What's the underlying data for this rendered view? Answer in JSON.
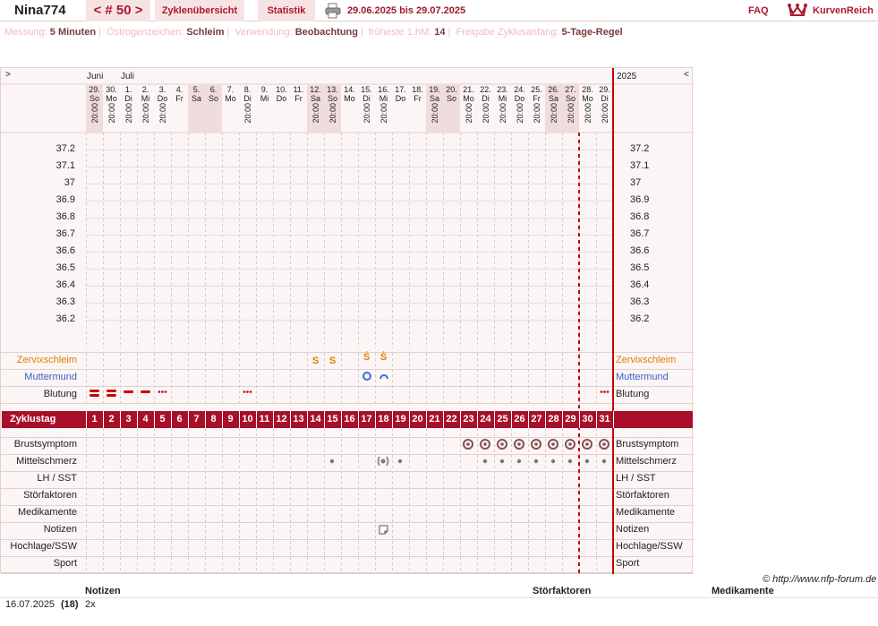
{
  "header": {
    "user": "Nina774",
    "cycle_nav": "< # 50 >",
    "tabs": [
      "Zyklenübersicht",
      "Statistik"
    ],
    "date_range": "29.06.2025 bis 29.07.2025",
    "faq": "FAQ",
    "brand": "KurvenReich"
  },
  "settings": [
    {
      "label": "Messung:",
      "value": "5 Minuten"
    },
    {
      "label": "Östrogenzeichen:",
      "value": "Schleim"
    },
    {
      "label": "Verwendung:",
      "value": "Beobachtung"
    },
    {
      "label": "früheste 1.hM:",
      "value": "14"
    },
    {
      "label": "Freigabe Zyklusanfang:",
      "value": "5-Tage-Regel"
    }
  ],
  "chart": {
    "left_arrow": ">",
    "right_arrow": "<",
    "year": "2025",
    "months": [
      "Juni",
      "Juli"
    ],
    "days": [
      {
        "date": "29.",
        "wd": "So",
        "time": "20:00",
        "we": true
      },
      {
        "date": "30.",
        "wd": "Mo",
        "time": "20:00",
        "we": false
      },
      {
        "date": "1.",
        "wd": "Di",
        "time": "20:00",
        "we": false
      },
      {
        "date": "2.",
        "wd": "Mi",
        "time": "20:00",
        "we": false
      },
      {
        "date": "3.",
        "wd": "Do",
        "time": "20:00",
        "we": false
      },
      {
        "date": "4.",
        "wd": "Fr",
        "time": "",
        "we": false
      },
      {
        "date": "5.",
        "wd": "Sa",
        "time": "",
        "we": true
      },
      {
        "date": "6.",
        "wd": "So",
        "time": "",
        "we": true
      },
      {
        "date": "7.",
        "wd": "Mo",
        "time": "",
        "we": false
      },
      {
        "date": "8.",
        "wd": "Di",
        "time": "20:00",
        "we": false
      },
      {
        "date": "9.",
        "wd": "Mi",
        "time": "",
        "we": false
      },
      {
        "date": "10.",
        "wd": "Do",
        "time": "",
        "we": false
      },
      {
        "date": "11.",
        "wd": "Fr",
        "time": "",
        "we": false
      },
      {
        "date": "12.",
        "wd": "Sa",
        "time": "20:00",
        "we": true
      },
      {
        "date": "13.",
        "wd": "So",
        "time": "20:00",
        "we": true
      },
      {
        "date": "14.",
        "wd": "Mo",
        "time": "",
        "we": false
      },
      {
        "date": "15.",
        "wd": "Di",
        "time": "20:00",
        "we": false
      },
      {
        "date": "16.",
        "wd": "Mi",
        "time": "20:00",
        "we": false
      },
      {
        "date": "17.",
        "wd": "Do",
        "time": "",
        "we": false
      },
      {
        "date": "18.",
        "wd": "Fr",
        "time": "",
        "we": false
      },
      {
        "date": "19.",
        "wd": "Sa",
        "time": "20:00",
        "we": true
      },
      {
        "date": "20.",
        "wd": "So",
        "time": "",
        "we": true
      },
      {
        "date": "21.",
        "wd": "Mo",
        "time": "20:00",
        "we": false
      },
      {
        "date": "22.",
        "wd": "Di",
        "time": "20:00",
        "we": false
      },
      {
        "date": "23.",
        "wd": "Mi",
        "time": "20:00",
        "we": false
      },
      {
        "date": "24.",
        "wd": "Do",
        "time": "20:00",
        "we": false
      },
      {
        "date": "25.",
        "wd": "Fr",
        "time": "20:00",
        "we": false
      },
      {
        "date": "26.",
        "wd": "Sa",
        "time": "20:00",
        "we": true
      },
      {
        "date": "27.",
        "wd": "So",
        "time": "20:00",
        "we": true
      },
      {
        "date": "28.",
        "wd": "Mo",
        "time": "20:00",
        "we": false
      },
      {
        "date": "29.",
        "wd": "Di",
        "time": "20:00",
        "we": false
      }
    ],
    "temperatures": [
      "37.2",
      "37.1",
      "37",
      "36.9",
      "36.8",
      "36.7",
      "36.6",
      "36.5",
      "36.4",
      "36.3",
      "36.2"
    ],
    "rows_top": [
      "Zervixschleim",
      "Muttermund",
      "Blutung"
    ],
    "cycle_label": "Zyklustag",
    "cycle_days": [
      "1",
      "2",
      "3",
      "4",
      "5",
      "6",
      "7",
      "8",
      "9",
      "10",
      "11",
      "12",
      "13",
      "14",
      "15",
      "16",
      "17",
      "18",
      "19",
      "20",
      "21",
      "22",
      "23",
      "24",
      "25",
      "26",
      "27",
      "28",
      "29",
      "30",
      "31"
    ],
    "rows_bottom": [
      "Brustsymptom",
      "Mittelschmerz",
      "LH / SST",
      "Störfaktoren",
      "Medikamente",
      "Notizen",
      "Hochlage/SSW",
      "Sport"
    ],
    "cervix_marks": [
      {
        "day": 14,
        "symbol": "S"
      },
      {
        "day": 15,
        "symbol": "S"
      },
      {
        "day": 17,
        "symbol": "Ṡ"
      },
      {
        "day": 18,
        "symbol": "Ṡ"
      }
    ],
    "bleeding": {
      "heavy": [
        1,
        2
      ],
      "medium": [
        3,
        4
      ],
      "spotting": [
        5,
        10,
        31
      ]
    },
    "os_marks": [
      17,
      18
    ],
    "breast": [
      23,
      24,
      25,
      26,
      27,
      28,
      29,
      30,
      31
    ],
    "midpain_dots": [
      15,
      19,
      24,
      25,
      26,
      27,
      28,
      29,
      30,
      31
    ],
    "midpain_strong": [
      18
    ],
    "note_days": [
      18
    ],
    "ovulation_line_day": 29,
    "colors": {
      "brand": "#b0172b",
      "cycle_bar": "#a8102a",
      "cervix": "#e07f00",
      "os": "#3a6fd0",
      "bleeding": "#cc0000",
      "breast": "#8a5050",
      "label_blue": "#3a5fc8",
      "label_orange": "#e07f00"
    }
  },
  "copyright": "© http://www.nfp-forum.de",
  "notes_table": {
    "headers": [
      "Notizen",
      "Störfaktoren",
      "Medikamente"
    ],
    "rows": [
      {
        "date": "16.07.2025",
        "cycle_day": "(18)",
        "note": "2x"
      }
    ]
  }
}
